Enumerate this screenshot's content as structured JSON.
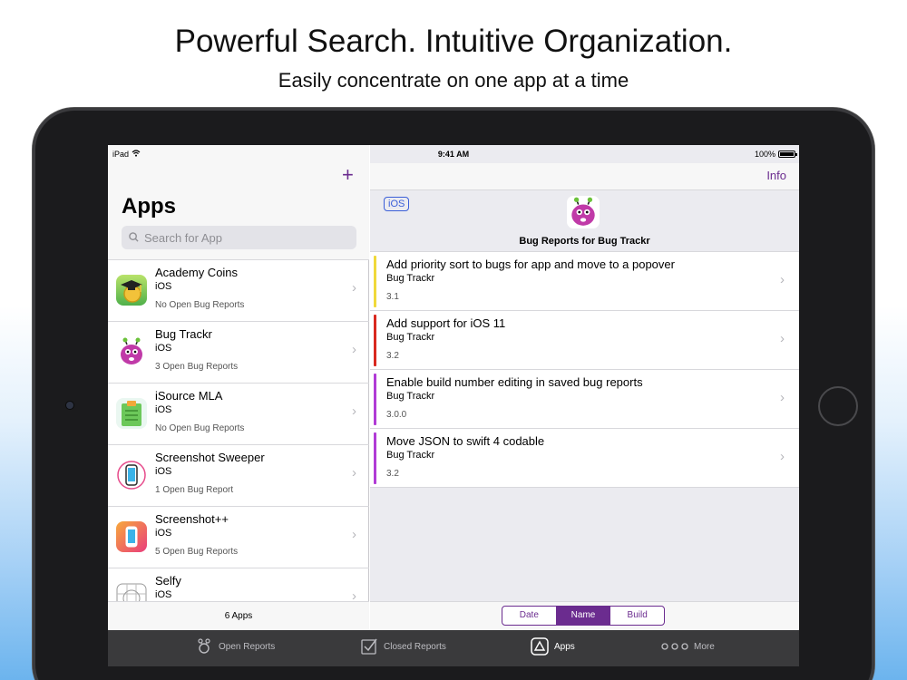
{
  "marketing": {
    "headline": "Powerful Search. Intuitive Organization.",
    "subheadline": "Easily concentrate on one app at a time"
  },
  "status_bar": {
    "device": "iPad",
    "time": "9:41 AM",
    "battery": "100%"
  },
  "master": {
    "add_label": "+",
    "title": "Apps",
    "search_placeholder": "Search for App",
    "apps": [
      {
        "name": "Academy Coins",
        "platform": "iOS",
        "reports": "No Open Bug Reports",
        "icon": "academy-coins-icon"
      },
      {
        "name": "Bug Trackr",
        "platform": "iOS",
        "reports": "3 Open Bug Reports",
        "icon": "bug-trackr-icon"
      },
      {
        "name": "iSource MLA",
        "platform": "iOS",
        "reports": "No Open Bug Reports",
        "icon": "isource-mla-icon"
      },
      {
        "name": "Screenshot Sweeper",
        "platform": "iOS",
        "reports": "1 Open Bug Report",
        "icon": "screenshot-sweeper-icon"
      },
      {
        "name": "Screenshot++",
        "platform": "iOS",
        "reports": "5 Open Bug Reports",
        "icon": "screenshot-plus-icon"
      },
      {
        "name": "Selfy",
        "platform": "iOS",
        "reports": "",
        "icon": "selfy-icon"
      }
    ],
    "footer": "6 Apps"
  },
  "detail": {
    "info_label": "Info",
    "platform_badge": "iOS",
    "title": "Bug Reports for Bug Trackr",
    "reports": [
      {
        "title": "Add priority sort to bugs for app and move to a popover",
        "app": "Bug Trackr",
        "version": "3.1",
        "color": "#f0d93a"
      },
      {
        "title": "Add support for iOS 11",
        "app": "Bug Trackr",
        "version": "3.2",
        "color": "#d9281f"
      },
      {
        "title": "Enable build number editing in saved bug reports",
        "app": "Bug Trackr",
        "version": "3.0.0",
        "color": "#b13bd6"
      },
      {
        "title": "Move JSON to swift 4 codable",
        "app": "Bug Trackr",
        "version": "3.2",
        "color": "#b13bd6"
      }
    ],
    "sort_options": [
      "Date",
      "Name",
      "Build"
    ],
    "sort_selected": "Name"
  },
  "tab_bar": {
    "tabs": [
      {
        "label": "Open Reports",
        "icon": "open-reports-icon",
        "active": false
      },
      {
        "label": "Closed Reports",
        "icon": "checkbox-icon",
        "active": false
      },
      {
        "label": "Apps",
        "icon": "apps-icon",
        "active": true
      },
      {
        "label": "More",
        "icon": "more-icon",
        "active": false
      }
    ]
  },
  "colors": {
    "accent": "#6b2c8f",
    "tab_bar": "#3a3a3c",
    "badge_blue": "#3a5ed8"
  }
}
